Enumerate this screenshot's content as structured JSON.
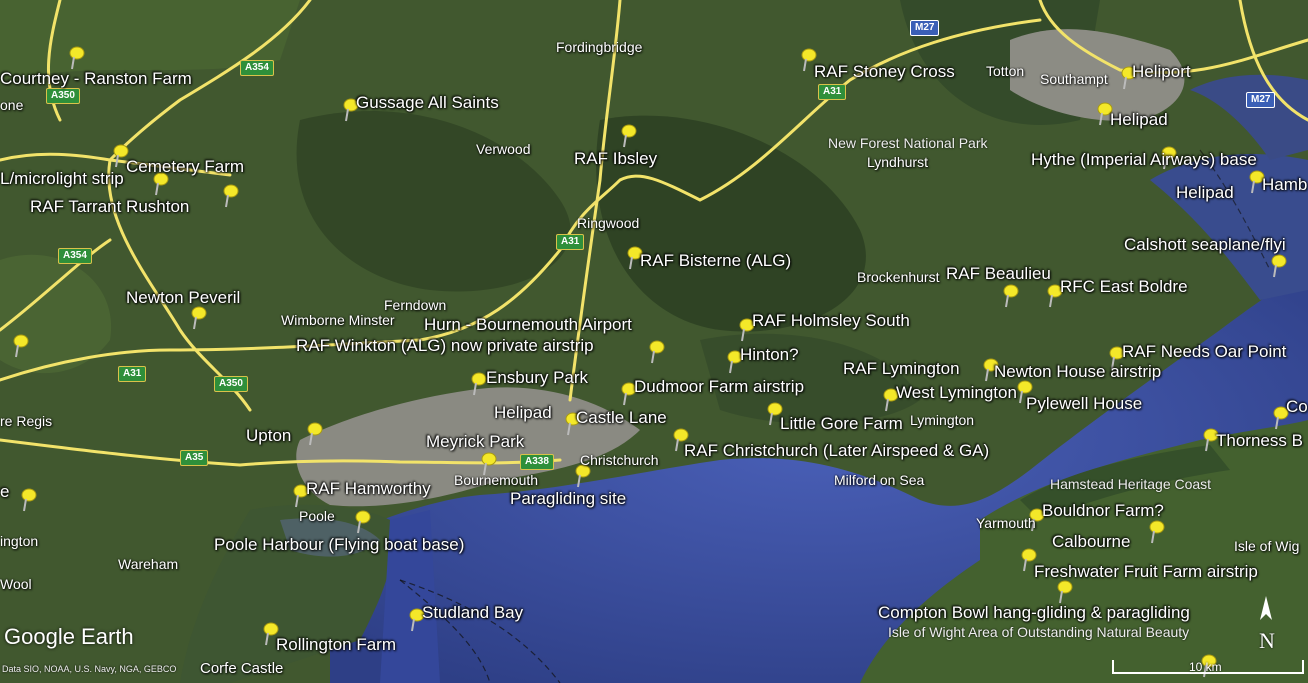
{
  "map_labels": {
    "courtney_ranston": "Courtney - Ranston Farm",
    "one": "one",
    "gussage": "Gussage All Saints",
    "cemetery_farm": "Cemetery Farm",
    "microlight": "L/microlight strip",
    "tarrant": "RAF Tarrant Rushton",
    "newton_peveril": "Newton Peveril",
    "re_regis": "re Regis",
    "upton": "Upton",
    "e_west": "e",
    "ington": "ington",
    "wool": "Wool",
    "wareham": "Wareham",
    "poole": "Poole",
    "raf_hamworthy": "RAF Hamworthy",
    "poole_harbour": "Poole Harbour (Flying boat base)",
    "studland": "Studland Bay",
    "rollington": "Rollington Farm",
    "corfe": "Corfe Castle",
    "fordingbridge": "Fordingbridge",
    "verwood": "Verwood",
    "raf_ibsley": "RAF Ibsley",
    "ringwood": "Ringwood",
    "raf_bisterne": "RAF Bisterne (ALG)",
    "ferndown": "Ferndown",
    "wimborne": "Wimborne Minster",
    "hurn": "Hurn - Bournemouth Airport",
    "winkton": "RAF Winkton (ALG) now private airstrip",
    "ensbury": "Ensbury Park",
    "dudmoor": "Dudmoor Farm airstrip",
    "helipad_bournemouth": "Helipad",
    "castle_lane": "Castle Lane",
    "meyrick": "Meyrick Park",
    "bournemouth": "Bournemouth",
    "christchurch": "Christchurch",
    "paragliding": "Paragliding site",
    "raf_christchurch": "RAF Christchurch (Later Airspeed & GA)",
    "hinton": "Hinton?",
    "raf_holmsley": "RAF Holmsley South",
    "little_gore": "Little Gore Farm",
    "raf_stoney": "RAF Stoney Cross",
    "new_forest": "New Forest National Park",
    "lyndhurst": "Lyndhurst",
    "brockenhurst": "Brockenhurst",
    "raf_beaulieu": "RAF Beaulieu",
    "rfc_east_boldre": "RFC East Boldre",
    "raf_lymington": "RAF Lymington",
    "west_lymington": "West Lymington",
    "lymington": "Lymington",
    "newton_house": "Newton House airstrip",
    "pylewell": "Pylewell House",
    "milford": "Milford on Sea",
    "totton": "Totton",
    "southampton": "Southampt",
    "heliport": "Heliport",
    "helipad_soton": "Helipad",
    "hythe": "Hythe (Imperial Airways) base",
    "helipad_hythe": "Helipad",
    "hamble": "Hamb",
    "calshott": "Calshott seaplane/flyi",
    "raf_needs_oar": "RAF Needs Oar Point",
    "co": "Co",
    "thorness": "Thorness B",
    "hamstead": "Hamstead Heritage Coast",
    "yarmouth": "Yarmouth",
    "bouldnor": "Bouldnor Farm?",
    "calbourne": "Calbourne",
    "isle_of_wig": "Isle of Wig",
    "freshwater": "Freshwater Fruit Farm airstrip",
    "compton": "Compton Bowl hang-gliding &  paragliding",
    "iow_aonb": "Isle of Wight Area of Outstanding Natural Beauty"
  },
  "roads": {
    "a354_1": "A354",
    "a350_1": "A350",
    "a354_2": "A354",
    "a31_1": "A31",
    "a350_2": "A350",
    "a35": "A35",
    "a338": "A338",
    "a31_2": "A31",
    "a31_3": "A31",
    "m27_1": "M27",
    "m27_2": "M27"
  },
  "branding": {
    "logo": "Google Earth",
    "attribution": "Data SIO, NOAA, U.S. Navy, NGA, GEBCO",
    "north_letter": "N",
    "scale_label": "10 km"
  },
  "colors": {
    "land": "#3f5a2e",
    "sea": "#3b52a6",
    "urban": "#8d8d85",
    "road": "#f2e36a",
    "pin": "#f4e829"
  },
  "pin_icon": "yellow-pushpin-icon"
}
